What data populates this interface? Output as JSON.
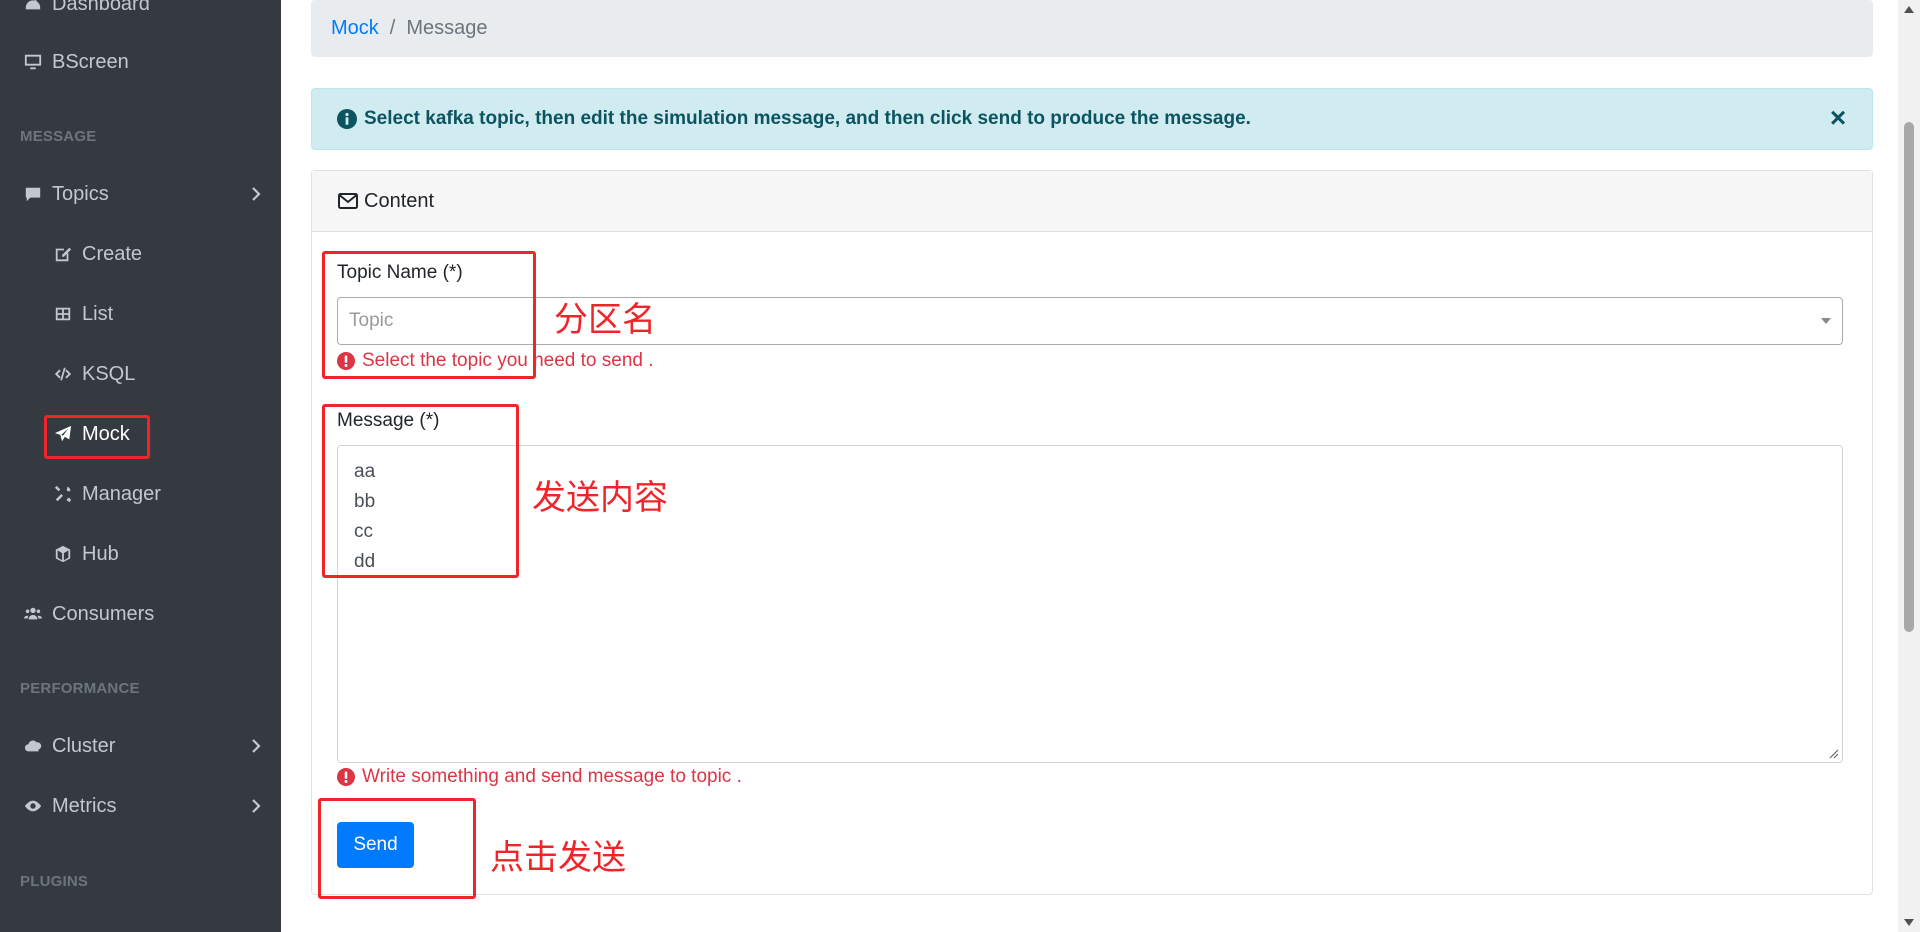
{
  "sidebar": {
    "items": [
      {
        "label": "Dashboard",
        "icon": "dashboard-icon"
      },
      {
        "label": "BScreen",
        "icon": "desktop-icon"
      },
      {
        "header": "MESSAGE"
      },
      {
        "label": "Topics",
        "icon": "comment-icon"
      },
      {
        "label": "Create",
        "icon": "edit-icon"
      },
      {
        "label": "List",
        "icon": "table-icon"
      },
      {
        "label": "KSQL",
        "icon": "code-icon"
      },
      {
        "label": "Mock",
        "icon": "paper-plane-icon",
        "active": true
      },
      {
        "label": "Manager",
        "icon": "tools-icon"
      },
      {
        "label": "Hub",
        "icon": "cube-icon"
      },
      {
        "label": "Consumers",
        "icon": "users-icon"
      },
      {
        "header": "PERFORMANCE"
      },
      {
        "label": "Cluster",
        "icon": "cloud-icon"
      },
      {
        "label": "Metrics",
        "icon": "eye-icon"
      },
      {
        "header": "PLUGINS"
      }
    ]
  },
  "breadcrumb": {
    "parent": "Mock",
    "separator": "/",
    "current": "Message"
  },
  "alert": {
    "text": "Select kafka topic, then edit the simulation message, and then click send to produce the message.",
    "close": "×"
  },
  "card": {
    "header": "Content",
    "topic_label": "Topic Name (*)",
    "topic_placeholder": "Topic",
    "topic_error": "Select the topic you need to send .",
    "message_label": "Message (*)",
    "message_lines": [
      "aa",
      "bb",
      "cc",
      "dd"
    ],
    "message_error": "Write something and send message to topic .",
    "send_label": "Send"
  },
  "annotations": {
    "topic_note": "分区名",
    "message_note": "发送内容",
    "send_note": "点击发送",
    "color": "#f0252a"
  },
  "colors": {
    "sidebar_bg": "#343a40",
    "primary": "#007bff",
    "danger": "#dc3545",
    "info_bg": "#d1ecf1"
  }
}
